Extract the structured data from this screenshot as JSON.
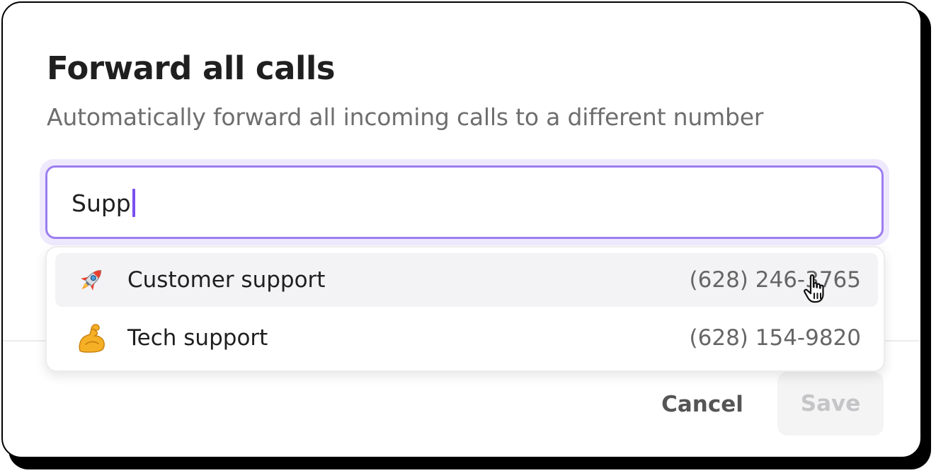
{
  "dialog": {
    "title": "Forward all calls",
    "subtitle": "Automatically forward all incoming calls to a different number"
  },
  "search": {
    "value": "Supp",
    "focused": true,
    "accent_color": "#9b7ef0"
  },
  "options": [
    {
      "icon": "rocket-icon",
      "label": "Customer support",
      "phone": "(628) 246-3765",
      "hovered": true
    },
    {
      "icon": "flexed-biceps-icon",
      "label": "Tech support",
      "phone": "(628) 154-9820",
      "hovered": false
    }
  ],
  "footer": {
    "cancel_label": "Cancel",
    "save_label": "Save",
    "save_disabled": true
  }
}
